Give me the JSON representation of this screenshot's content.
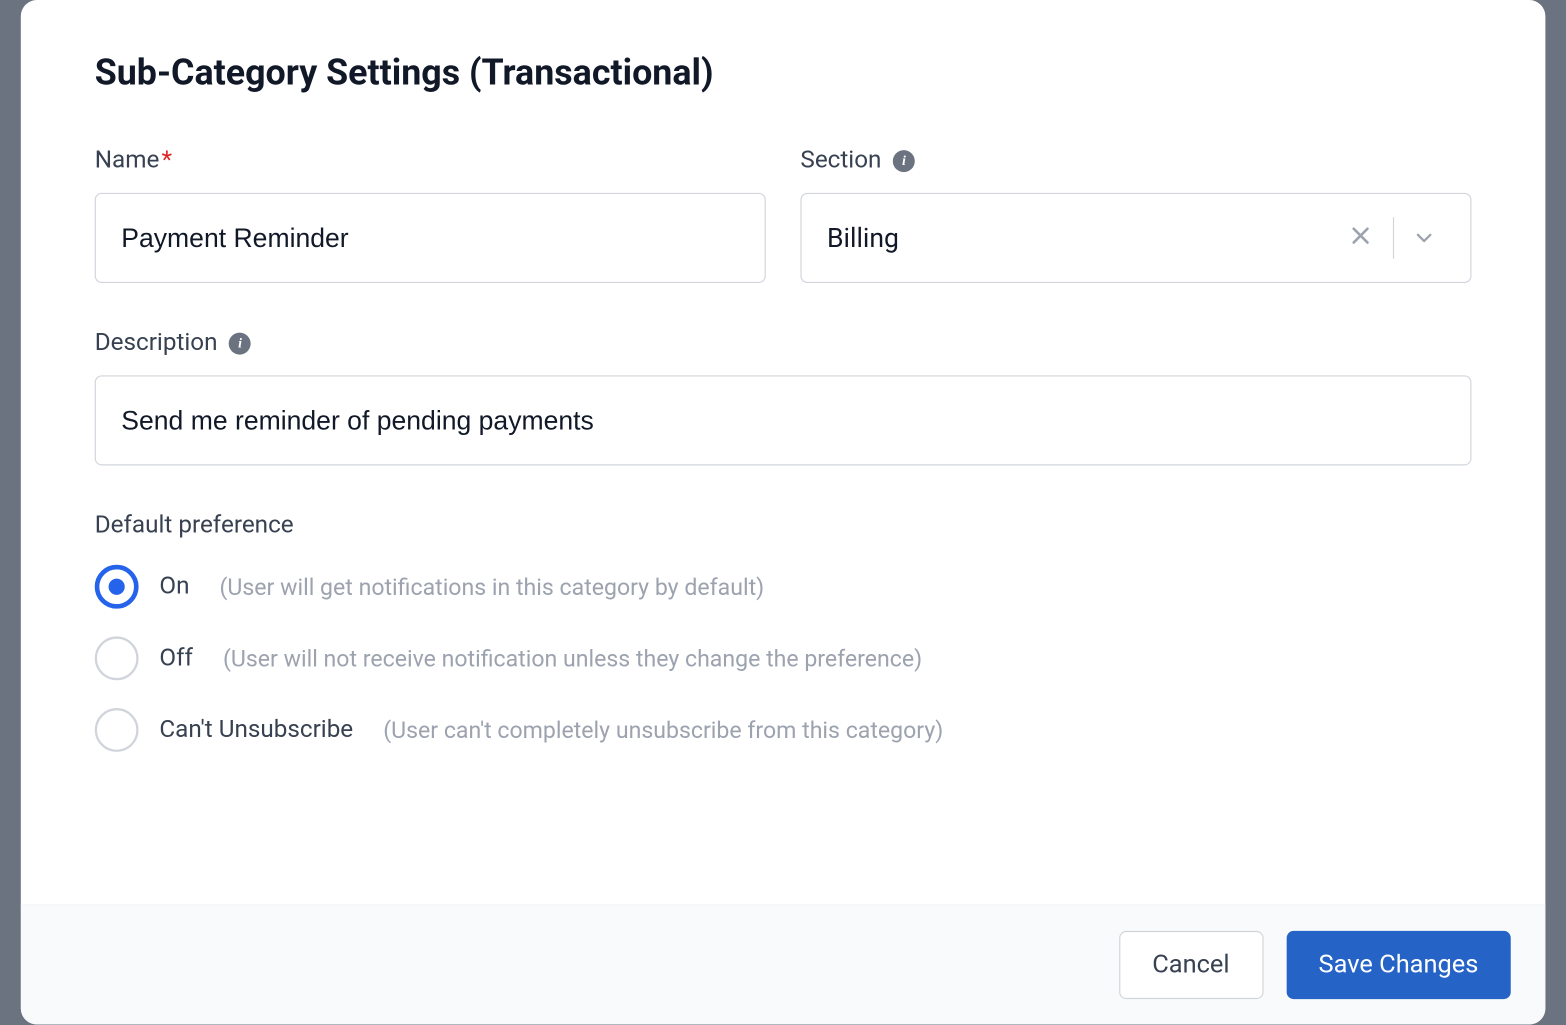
{
  "modal": {
    "title": "Sub-Category Settings (Transactional)"
  },
  "form": {
    "name": {
      "label": "Name",
      "required": "*",
      "value": "Payment Reminder"
    },
    "section": {
      "label": "Section",
      "value": "Billing"
    },
    "description": {
      "label": "Description",
      "value": "Send me reminder of pending payments"
    },
    "defaultPreference": {
      "label": "Default preference",
      "options": [
        {
          "label": "On",
          "hint": "(User will get notifications in this category by default)",
          "selected": true
        },
        {
          "label": "Off",
          "hint": "(User will not receive notification unless they change the preference)",
          "selected": false
        },
        {
          "label": "Can't Unsubscribe",
          "hint": "(User can't completely unsubscribe from this category)",
          "selected": false
        }
      ]
    }
  },
  "footer": {
    "cancel": "Cancel",
    "save": "Save Changes"
  }
}
